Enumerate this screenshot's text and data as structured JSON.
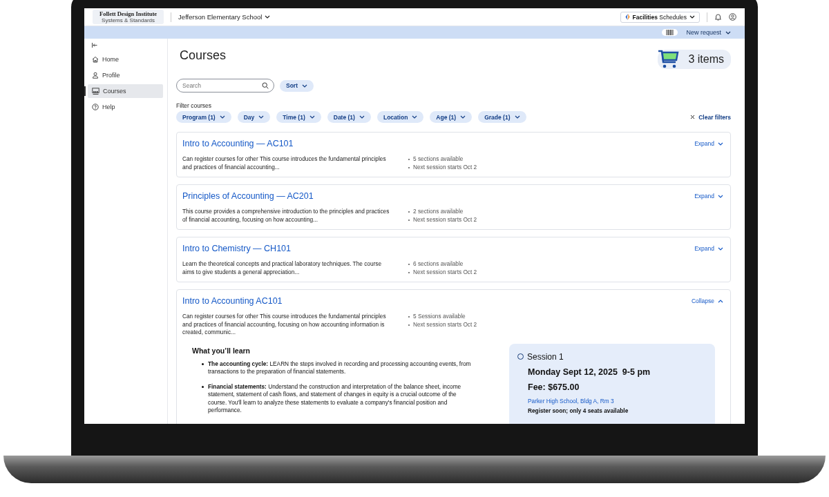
{
  "header": {
    "logo_title": "Follett Design Institute",
    "logo_subtitle": "Systems & Standards",
    "school": "Jefferson Elementary School",
    "app_switcher": "**Facilities** Schedules"
  },
  "subbar": {
    "new_request": "New request"
  },
  "sidebar": {
    "items": [
      {
        "label": "Home",
        "selected": false
      },
      {
        "label": "Profile",
        "selected": false
      },
      {
        "label": "Courses",
        "selected": true
      },
      {
        "label": "Help",
        "selected": false
      }
    ]
  },
  "page": {
    "title": "Courses",
    "cart": "3 items",
    "search": {
      "placeholder": "Search"
    },
    "sort": "Sort",
    "filter_label": "Filter courses",
    "filters": [
      "Program (1)",
      "Day",
      "Time (1)",
      "Date (1)",
      "Location",
      "Age (1)",
      "Grade (1)"
    ],
    "clear_filters": "Clear filters"
  },
  "courses": [
    {
      "title": "Intro to Accounting — AC101",
      "description": "Can register courses for other This course introduces the fundamental principles and practices of financial accounting...",
      "sections": "5 sections available",
      "next_session": "Next session starts Oct 2",
      "toggle": "Expand",
      "expanded": false
    },
    {
      "title": "Principles of Accounting — AC201",
      "description": "This course provides a comprehensive introduction to the principles and practices of financial accounting, focusing on how accounting...",
      "sections": "2 sections available",
      "next_session": "Next session starts Oct 2",
      "toggle": "Expand",
      "expanded": false
    },
    {
      "title": "Intro to Chemistry — CH101",
      "description": "Learn the theoretical concepts and practical laboratory techniques. The course aims to give students a general appreciation...",
      "sections": "6 sections available",
      "next_session": "Next session starts Oct 2",
      "toggle": "Expand",
      "expanded": false
    },
    {
      "title": "Intro to Accounting AC101",
      "description": "Can register courses for other This course introduces the fundamental principles and practices of financial accounting, focusing on how accounting information is created, communic...",
      "sections": "5 Sessions available",
      "next_session": "Next session starts Oct 2",
      "toggle": "Collapse",
      "expanded": true,
      "learn": {
        "heading": "What you’ll learn",
        "points": [
          "**The accounting cycle:** LEARN the steps involved in recording and processing accounting events, from transactions to the preparation of financial statements.",
          "**Financial statements:** Understand the construction and interpretation of the balance sheet, income statement, statement of cash flows, and statement of changes in equity is a crucial outcome of the course. You'll learn to analyze these statements to evaluate a company's financial position and performance."
        ]
      },
      "session": {
        "name": "Session 1",
        "selected": false,
        "date": "Monday Sept 12, 2025  9-5 pm",
        "fee": "Fee: $675.00",
        "location": "Parker High School, Bldg A, Rm 3",
        "note": "Register soon; only 4 seats available"
      }
    }
  ]
}
